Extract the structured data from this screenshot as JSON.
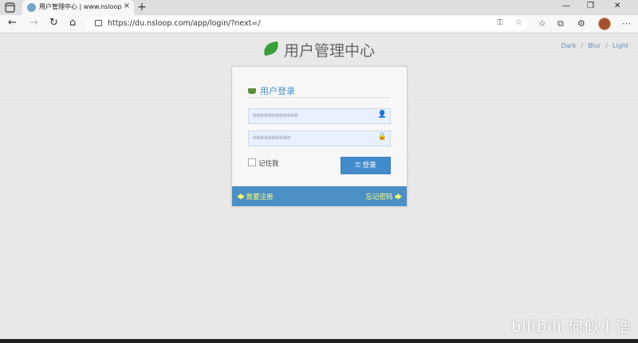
{
  "browser": {
    "tab_title": "用户管理中心 | www.nsloop.com",
    "tab_close": "×",
    "new_tab": "+",
    "window_controls": [
      "—",
      "❐",
      "✕"
    ],
    "url": "https://du.nsloop.com/app/login/?next=/",
    "nav": {
      "back": "←",
      "forward": "→",
      "reload": "↻",
      "home": "⌂"
    }
  },
  "page": {
    "brand": "用户管理中心",
    "theme_links": [
      "Dark",
      "Blur",
      "Light"
    ],
    "theme_sep": "/",
    "login": {
      "heading": "用户登录",
      "username_value": "••••••••••••",
      "password_value": "••••••••••",
      "remember_label": "记住我",
      "login_button": "登录",
      "register_link": "我要注册",
      "forgot_link": "忘记密码"
    }
  },
  "watermark": "bilibili 何似小浩",
  "colors": {
    "accent": "#428bca",
    "footer": "#4c8fc4",
    "footer_text": "#fefe78",
    "brand_leaf": "#3a9e3a"
  }
}
